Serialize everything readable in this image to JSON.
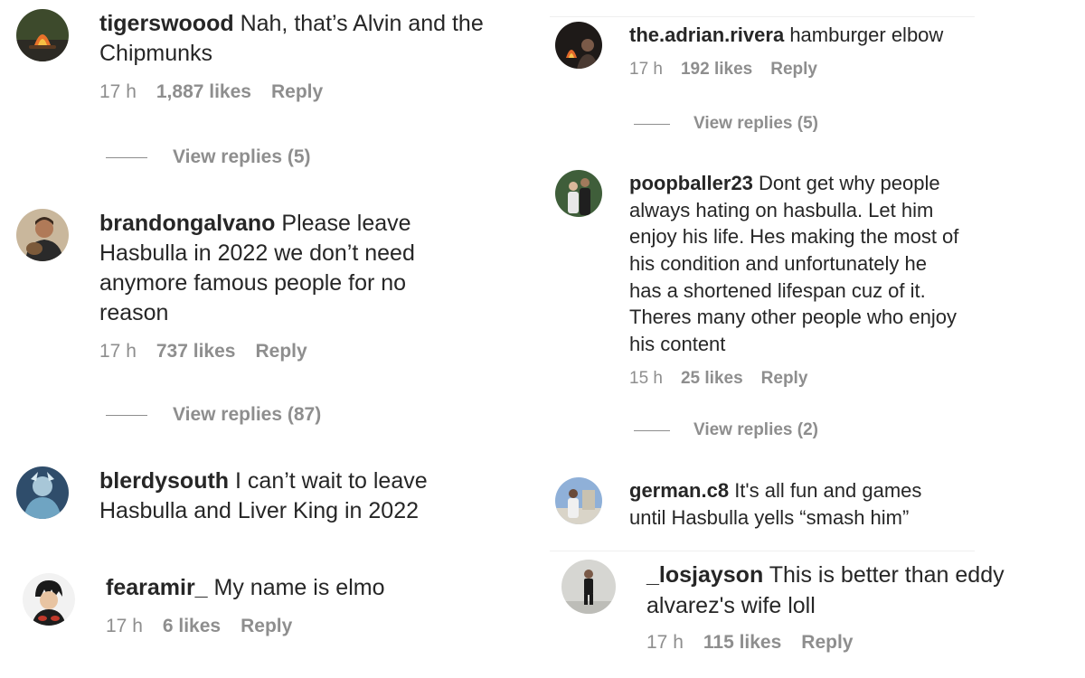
{
  "comments": [
    {
      "username": "tigerswoood",
      "text": "Nah, that’s Alvin and the Chipmunks",
      "time": "17 h",
      "likes": "1,887 likes",
      "reply": "Reply",
      "view_replies": "View replies (5)"
    },
    {
      "username": "brandongalvano",
      "text": "Please leave Hasbulla in 2022 we don’t need anymore famous people for no reason",
      "time": "17 h",
      "likes": "737 likes",
      "reply": "Reply",
      "view_replies": "View replies (87)"
    },
    {
      "username": "blerdysouth",
      "text": "I can’t wait to leave Hasbulla and Liver King in 2022"
    },
    {
      "username": "fearamir_",
      "text": "My name is elmo",
      "time": "17 h",
      "likes": "6 likes",
      "reply": "Reply"
    },
    {
      "username": "the.adrian.rivera",
      "text": "hamburger elbow",
      "time": "17 h",
      "likes": "192 likes",
      "reply": "Reply",
      "view_replies": "View replies (5)"
    },
    {
      "username": "poopballer23",
      "text": "Dont get why people always hating on hasbulla. Let him enjoy his life. Hes making the most of his condition and unfortunately he has a shortened lifespan cuz of it. Theres many other people who enjoy his content",
      "time": "15 h",
      "likes": "25 likes",
      "reply": "Reply",
      "view_replies": "View replies (2)"
    },
    {
      "username": "german.c8",
      "text": "It's all fun and games until Hasbulla yells “smash him”"
    },
    {
      "username": "_losjayson",
      "text": "This is better than eddy alvarez's wife loll",
      "time": "17 h",
      "likes": "115 likes",
      "reply": "Reply"
    }
  ],
  "colors": {
    "text": "#262626",
    "muted": "#8e8e8e",
    "divider": "#efefef"
  },
  "avatar_icons": [
    "campfire-avatar-icon",
    "man-with-dog-avatar-icon",
    "anime-character-avatar-icon",
    "ninja-cartoon-avatar-icon",
    "campfire-night-avatar-icon",
    "two-people-avatar-icon",
    "person-at-monument-avatar-icon",
    "standing-person-avatar-icon"
  ]
}
